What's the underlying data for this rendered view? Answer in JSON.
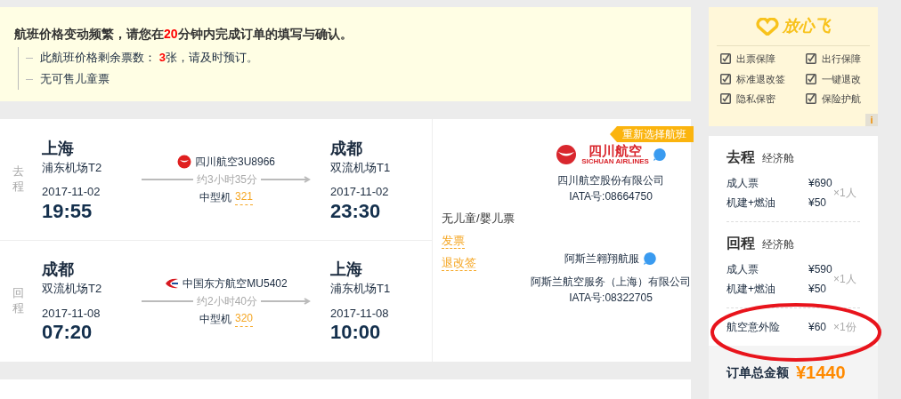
{
  "notice": {
    "headline": "航班价格变动频繁，请您在**20**分钟内完成订单的填写与确认。",
    "lines": [
      "此航班价格剩余票数： **3**张，请及时预订。",
      "无可售儿童票"
    ]
  },
  "reselect_button": "重新选择航班",
  "segments": [
    {
      "label": "去程",
      "from": {
        "city": "上海",
        "airport": "浦东机场T2",
        "date": "2017-11-02",
        "time": "19:55"
      },
      "to": {
        "city": "成都",
        "airport": "双流机场T1",
        "date": "2017-11-02",
        "time": "23:30"
      },
      "airline": "四川航空3U8966",
      "kind": "sichuan",
      "duration": "约3小时35分",
      "plane": "中型机",
      "model": "321"
    },
    {
      "label": "回程",
      "from": {
        "city": "成都",
        "airport": "双流机场T2",
        "date": "2017-11-08",
        "time": "07:20"
      },
      "to": {
        "city": "上海",
        "airport": "浦东机场T1",
        "date": "2017-11-08",
        "time": "10:00"
      },
      "airline": "中国东方航空MU5402",
      "kind": "eastern",
      "duration": "约2小时40分",
      "plane": "中型机",
      "model": "320"
    }
  ],
  "extras": {
    "note": "无儿童/婴儿票",
    "links": [
      "发票",
      "退改签"
    ]
  },
  "sellers": [
    {
      "kind": "logo",
      "logo_name": "四川航空",
      "logo_sub": "SICHUAN AIRLINES",
      "company": "四川航空股份有限公司",
      "iata": "IATA号:08664750"
    },
    {
      "kind": "agent",
      "name": "阿斯兰翱翔航服",
      "company": "阿斯兰航空服务（上海）有限公司",
      "iata": "IATA号:08322705"
    }
  ],
  "assurance": {
    "logo": "放心飞",
    "items": [
      "出票保障",
      "出行保障",
      "标准退改签",
      "一键退改",
      "隐私保密",
      "保险护航"
    ],
    "info": "i"
  },
  "price": {
    "segments": [
      {
        "title": "去程",
        "cabin": "经济舱",
        "qty": "×1人",
        "items": [
          {
            "label": "成人票",
            "price": "¥690"
          },
          {
            "label": "机建+燃油",
            "price": "¥50"
          }
        ]
      },
      {
        "title": "回程",
        "cabin": "经济舱",
        "qty": "×1人",
        "items": [
          {
            "label": "成人票",
            "price": "¥590"
          },
          {
            "label": "机建+燃油",
            "price": "¥50"
          }
        ]
      }
    ],
    "insurance": {
      "label": "航空意外险",
      "price": "¥60",
      "qty": "×1份",
      "highlighted": true
    },
    "total": {
      "label": "订单总金额",
      "amount": "¥1440"
    }
  }
}
